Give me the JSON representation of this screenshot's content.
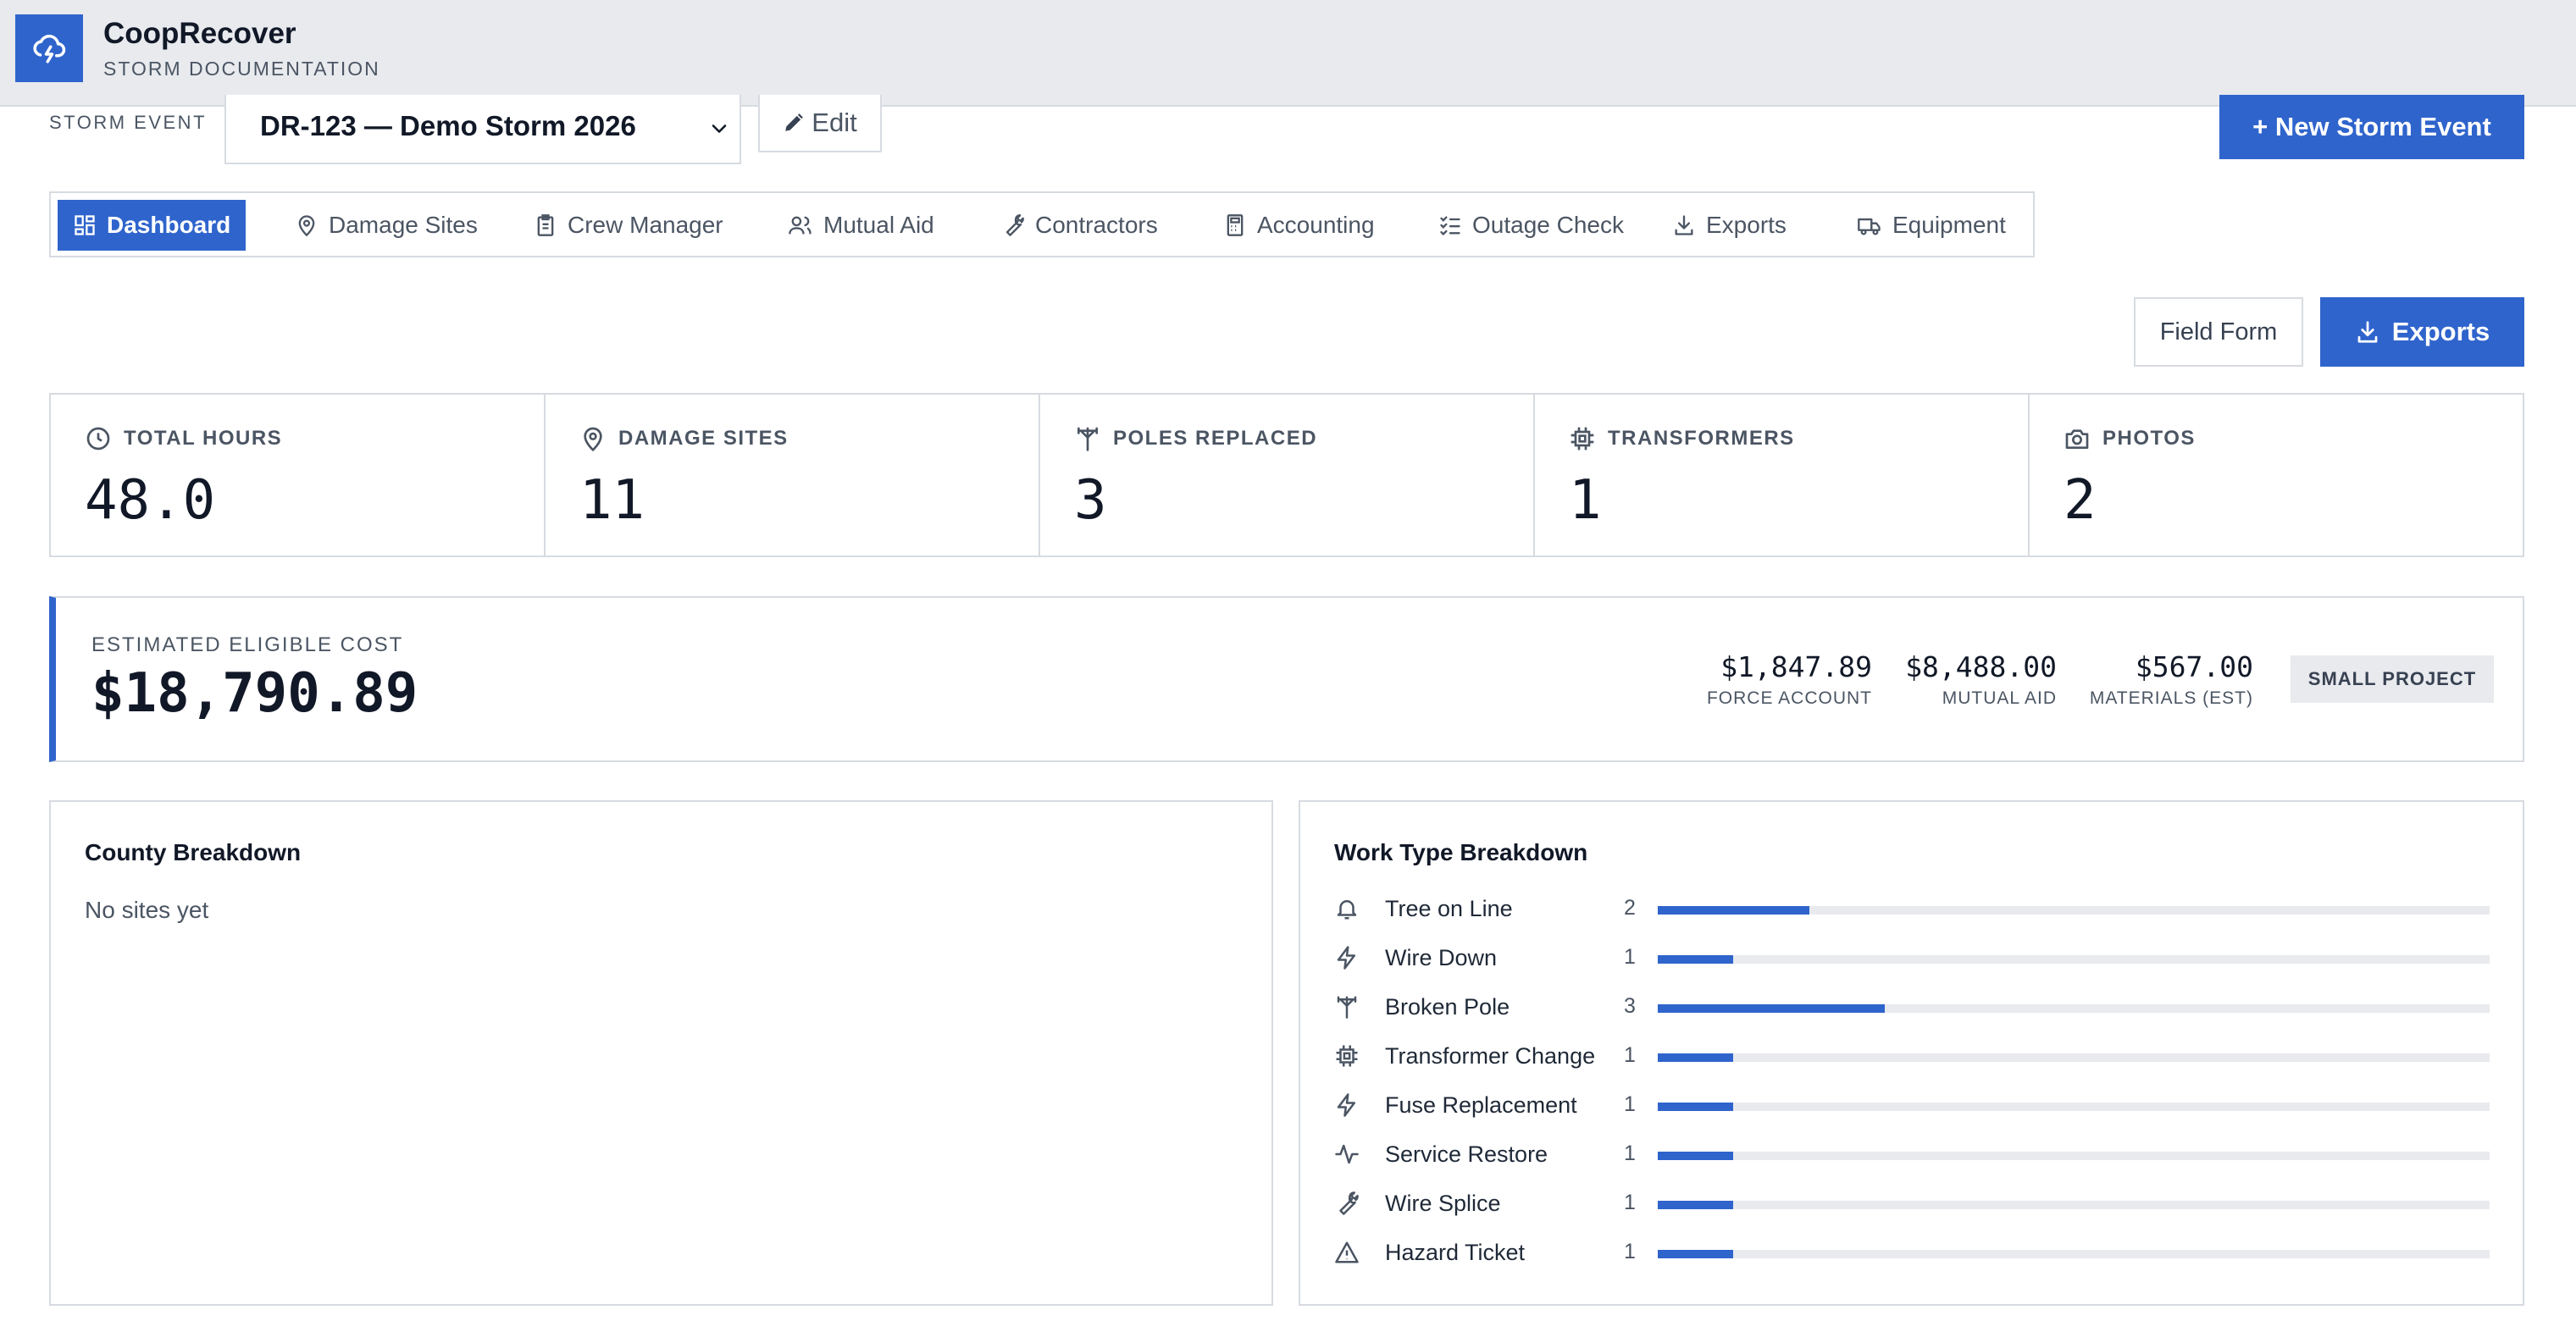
{
  "app": {
    "name": "CoopRecover",
    "subtitle": "STORM DOCUMENTATION",
    "logo_icon": "cloud-lightning-icon"
  },
  "storm": {
    "label": "STORM EVENT",
    "selected": "DR-123 — Demo Storm 2026",
    "edit_label": "Edit",
    "new_label": "+ New Storm Event"
  },
  "tabs": [
    {
      "label": "Dashboard",
      "icon": "dashboard-grid-icon",
      "active": true
    },
    {
      "label": "Damage Sites",
      "icon": "map-pin-icon"
    },
    {
      "label": "Crew Manager",
      "icon": "clipboard-icon"
    },
    {
      "label": "Mutual Aid",
      "icon": "users-icon"
    },
    {
      "label": "Contractors",
      "icon": "wrench-icon"
    },
    {
      "label": "Accounting",
      "icon": "calculator-icon"
    },
    {
      "label": "Outage Check",
      "icon": "checklist-icon"
    },
    {
      "label": "Exports",
      "icon": "download-icon"
    },
    {
      "label": "Equipment",
      "icon": "truck-icon"
    }
  ],
  "actions": {
    "field_form": "Field Form",
    "exports": "Exports"
  },
  "stats": [
    {
      "label": "TOTAL HOURS",
      "value": "48.0",
      "icon": "clock-icon"
    },
    {
      "label": "DAMAGE SITES",
      "value": "11",
      "icon": "map-pin-icon"
    },
    {
      "label": "POLES REPLACED",
      "value": "3",
      "icon": "utility-pole-icon"
    },
    {
      "label": "TRANSFORMERS",
      "value": "1",
      "icon": "chip-icon"
    },
    {
      "label": "PHOTOS",
      "value": "2",
      "icon": "camera-icon"
    }
  ],
  "cost": {
    "label": "ESTIMATED ELIGIBLE COST",
    "value": "$18,790.89",
    "items": [
      {
        "value": "$1,847.89",
        "label": "FORCE ACCOUNT"
      },
      {
        "value": "$8,488.00",
        "label": "MUTUAL AID"
      },
      {
        "value": "$567.00",
        "label": "MATERIALS (EST)"
      }
    ],
    "badge": "SMALL PROJECT"
  },
  "county": {
    "title": "County Breakdown",
    "empty": "No sites yet"
  },
  "work_types": {
    "title": "Work Type Breakdown",
    "max": 11,
    "accent": "#2f64cc",
    "items": [
      {
        "label": "Tree on Line",
        "count": 2,
        "icon": "bell-icon"
      },
      {
        "label": "Wire Down",
        "count": 1,
        "icon": "bolt-icon"
      },
      {
        "label": "Broken Pole",
        "count": 3,
        "icon": "utility-pole-icon"
      },
      {
        "label": "Transformer Change",
        "count": 1,
        "icon": "chip-icon"
      },
      {
        "label": "Fuse Replacement",
        "count": 1,
        "icon": "bolt-icon"
      },
      {
        "label": "Service Restore",
        "count": 1,
        "icon": "activity-icon"
      },
      {
        "label": "Wire Splice",
        "count": 1,
        "icon": "wrench-icon"
      },
      {
        "label": "Hazard Ticket",
        "count": 1,
        "icon": "warning-icon"
      }
    ]
  }
}
